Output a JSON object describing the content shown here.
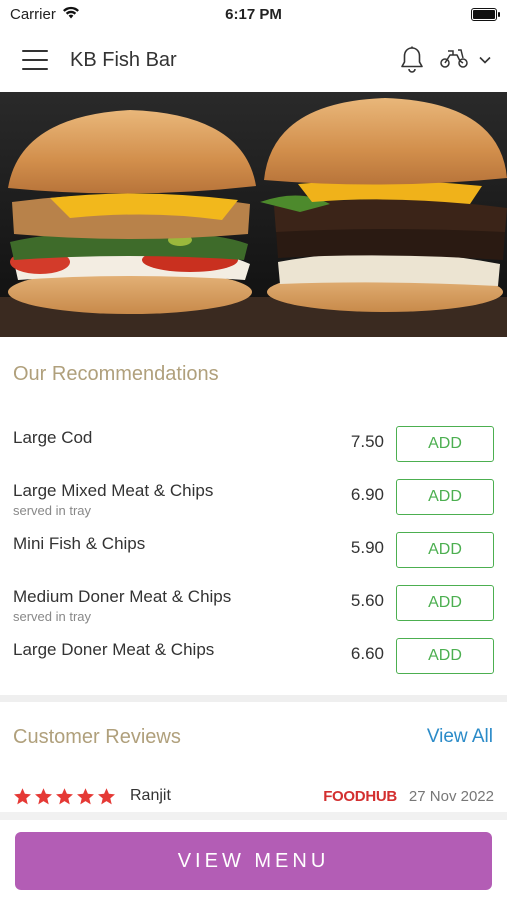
{
  "status_bar": {
    "carrier": "Carrier",
    "time": "6:17 PM"
  },
  "header": {
    "title": "KB Fish Bar",
    "menu_icon": "hamburger-menu-icon",
    "bell_icon": "bell-icon",
    "delivery_icon": "scooter-icon",
    "dropdown_icon": "chevron-down-icon"
  },
  "hero": {
    "image": "burgers-photo"
  },
  "recommendations": {
    "title": "Our Recommendations",
    "items": [
      {
        "name": "Large Cod",
        "description": "",
        "price": "7.50",
        "add_label": "ADD"
      },
      {
        "name": "Large Mixed Meat & Chips",
        "description": "served in tray",
        "price": "6.90",
        "add_label": "ADD"
      },
      {
        "name": "Mini Fish & Chips",
        "description": "",
        "price": "5.90",
        "add_label": "ADD"
      },
      {
        "name": "Medium Doner Meat & Chips",
        "description": "served in tray",
        "price": "5.60",
        "add_label": "ADD"
      },
      {
        "name": "Large Doner Meat & Chips",
        "description": "",
        "price": "6.60",
        "add_label": "ADD"
      }
    ]
  },
  "reviews": {
    "title": "Customer Reviews",
    "view_all": "View All",
    "items": [
      {
        "rating": 5,
        "reviewer": "Ranjit",
        "source": "FOODHUB",
        "date": "27 Nov 2022"
      }
    ]
  },
  "bottom": {
    "view_menu_label": "VIEW MENU"
  },
  "colors": {
    "accent_green": "#4caf50",
    "section_title": "#b0a07c",
    "link_blue": "#2b8bc8",
    "button_purple": "#b35db5",
    "star_red": "#e53935",
    "brand_red": "#d32f2f"
  }
}
